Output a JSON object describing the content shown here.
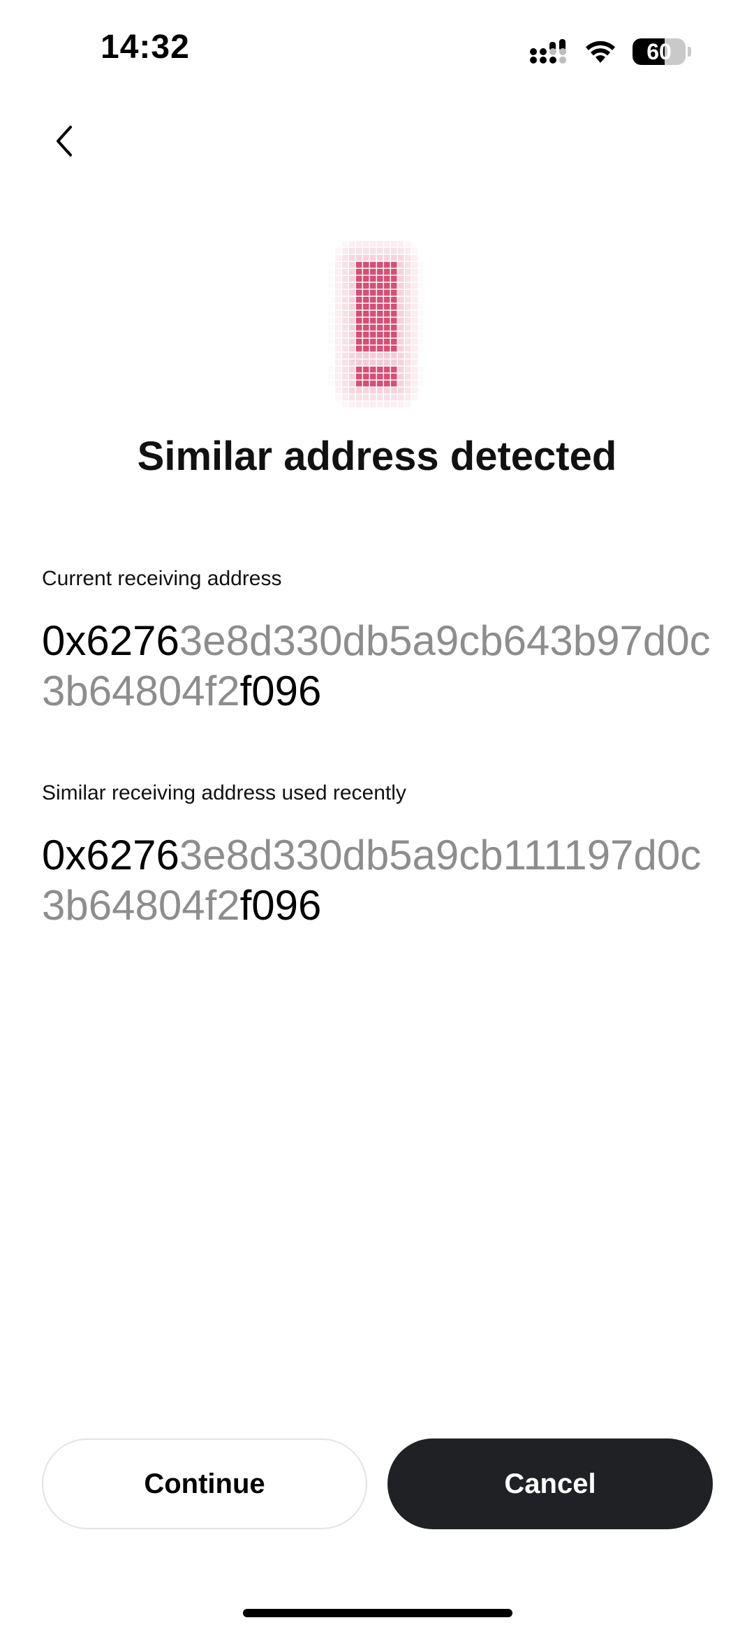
{
  "status_bar": {
    "time": "14:32",
    "battery_level": "60",
    "icons": [
      "signal-icon",
      "wifi-icon",
      "battery-icon"
    ]
  },
  "nav": {
    "back_icon": "chevron-left-icon"
  },
  "warning": {
    "icon": "exclamation-pixel-icon",
    "accent_color": "#d6456e"
  },
  "title": "Similar address detected",
  "current": {
    "label": "Current receiving address",
    "prefix": "0x6276",
    "middle": "3e8d330db5a9cb643b97d0c3b64804f2",
    "suffix": "f096"
  },
  "similar": {
    "label": "Similar receiving address used recently",
    "prefix": "0x6276",
    "middle": "3e8d330db5a9cb111197d0c3b64804f2",
    "suffix": "f096"
  },
  "buttons": {
    "continue_label": "Continue",
    "cancel_label": "Cancel"
  }
}
